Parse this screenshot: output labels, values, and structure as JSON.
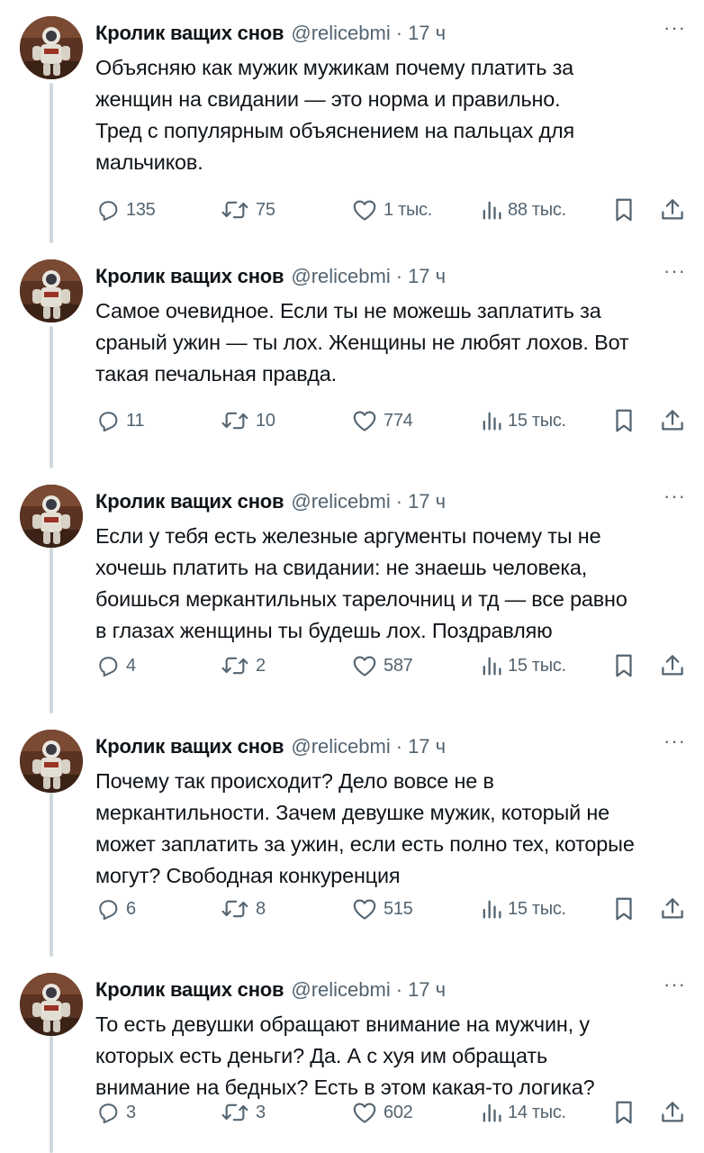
{
  "author": {
    "name": "Кролик ващих снов",
    "handle": "@relicebmi",
    "separator": "·"
  },
  "more_label": "···",
  "tweets": [
    {
      "time": "17 ч",
      "text": "Объясняю как мужик мужикам почему платить за\nженщин на свидании — это норма и правильно.\nТред с популярным объяснением на пальцах для\nмальчиков.",
      "replies": "135",
      "retweets": "75",
      "likes": "1 тыс.",
      "views": "88 тыс."
    },
    {
      "time": "17 ч",
      "text": "Самое очевидное. Если ты не можешь заплатить за\nсраный ужин — ты лох. Женщины не любят лохов. Вот\nтакая печальная правда.",
      "replies": "11",
      "retweets": "10",
      "likes": "774",
      "views": "15 тыс."
    },
    {
      "time": "17 ч",
      "text": "Если у тебя есть железные аргументы почему ты не\nхочешь платить на свидании: не знаешь человека,\nбоишься меркантильных тарелочниц и тд — все равно\nв глазах женщины ты будешь лох. Поздравляю",
      "replies": "4",
      "retweets": "2",
      "likes": "587",
      "views": "15 тыс."
    },
    {
      "time": "17 ч",
      "text": "Почему так происходит? Дело вовсе не в\nмеркантильности. Зачем девушке мужик, который не\nможет заплатить за ужин, если есть полно тех, которые\nмогут? Свободная конкуренция",
      "replies": "6",
      "retweets": "8",
      "likes": "515",
      "views": "15 тыс."
    },
    {
      "time": "17 ч",
      "text": "То есть девушки обращают внимание на мужчин, у\nкоторых есть деньги? Да. А с хуя им обращать\nвнимание на бедных? Есть в этом какая-то логика?",
      "replies": "3",
      "retweets": "3",
      "likes": "602",
      "views": "14 тыс."
    }
  ],
  "colors": {
    "text": "#0f1419",
    "secondary": "#536471",
    "thread_line": "#cfd9de",
    "background": "#ffffff"
  },
  "icons": [
    "reply-icon",
    "retweet-icon",
    "like-icon",
    "views-icon",
    "bookmark-icon",
    "share-icon",
    "more-icon",
    "avatar-astronaut"
  ]
}
